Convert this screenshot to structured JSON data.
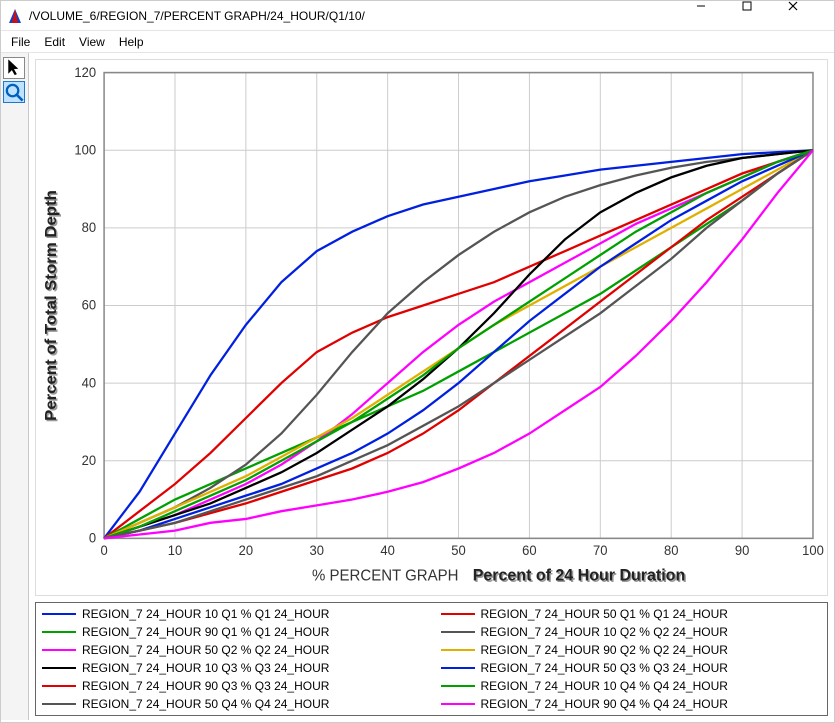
{
  "window": {
    "title": "/VOLUME_6/REGION_7/PERCENT GRAPH/24_HOUR/Q1/10/"
  },
  "menubar": [
    "File",
    "Edit",
    "View",
    "Help"
  ],
  "toolbar": {
    "pointer_tooltip": "Pointer",
    "zoom_tooltip": "Zoom"
  },
  "chart_data": {
    "type": "line",
    "title": "",
    "xlabel_prefix": "% PERCENT GRAPH",
    "xlabel": "Percent of 24 Hour Duration",
    "ylabel": "Percent of Total Storm Depth",
    "xlim": [
      0,
      100
    ],
    "ylim": [
      0,
      120
    ],
    "xticks": [
      0,
      10,
      20,
      30,
      40,
      50,
      60,
      70,
      80,
      90,
      100
    ],
    "yticks": [
      0,
      20,
      40,
      60,
      80,
      100,
      120
    ],
    "x": [
      0,
      5,
      10,
      15,
      20,
      25,
      30,
      35,
      40,
      45,
      50,
      55,
      60,
      65,
      70,
      75,
      80,
      85,
      90,
      95,
      100
    ],
    "series": [
      {
        "name": "REGION_7 24_HOUR 10 Q1 % Q1 24_HOUR",
        "color": "#0020e0",
        "values": [
          0,
          12,
          27,
          42,
          55,
          66,
          74,
          79,
          83,
          86,
          88,
          90,
          92,
          93.5,
          95,
          96,
          97,
          98,
          99,
          99.5,
          100
        ]
      },
      {
        "name": "REGION_7 24_HOUR 50 Q1 % Q1 24_HOUR",
        "color": "#e00000",
        "values": [
          0,
          7,
          14,
          22,
          31,
          40,
          48,
          53,
          57,
          60,
          63,
          66,
          70,
          74,
          78,
          82,
          86,
          90,
          94,
          97,
          100
        ]
      },
      {
        "name": "REGION_7 24_HOUR 90 Q1 % Q1 24_HOUR",
        "color": "#00a000",
        "values": [
          0,
          5,
          10,
          14,
          18,
          22,
          26,
          30,
          34,
          38,
          43,
          48,
          53,
          58,
          63,
          69,
          75,
          81,
          87,
          94,
          100
        ]
      },
      {
        "name": "REGION_7 24_HOUR 10 Q2 % Q2 24_HOUR",
        "color": "#555555",
        "values": [
          0,
          4,
          8,
          13,
          19,
          27,
          37,
          48,
          58,
          66,
          73,
          79,
          84,
          88,
          91,
          93.5,
          95.5,
          97,
          98,
          99,
          100
        ]
      },
      {
        "name": "REGION_7 24_HOUR 50 Q2 % Q2 24_HOUR",
        "color": "#ff00ff",
        "values": [
          0,
          3,
          6,
          10,
          14,
          19,
          25,
          32,
          40,
          48,
          55,
          61,
          66,
          71,
          76,
          81,
          85,
          89,
          93,
          97,
          100
        ]
      },
      {
        "name": "REGION_7 24_HOUR 90 Q2 % Q2 24_HOUR",
        "color": "#e0b000",
        "values": [
          0,
          4,
          8,
          12,
          16,
          21,
          26,
          31,
          37,
          43,
          49,
          55,
          60,
          65,
          70,
          75,
          80,
          85,
          90,
          95,
          100
        ]
      },
      {
        "name": "REGION_7 24_HOUR 10 Q3 % Q3 24_HOUR",
        "color": "#000000",
        "values": [
          0,
          3,
          6,
          9,
          13,
          17,
          22,
          28,
          34,
          41,
          49,
          58,
          68,
          77,
          84,
          89,
          93,
          96,
          98,
          99,
          100
        ]
      },
      {
        "name": "REGION_7 24_HOUR 50 Q3 % Q3 24_HOUR",
        "color": "#0020e0",
        "values": [
          0,
          2,
          5,
          8,
          11,
          14,
          18,
          22,
          27,
          33,
          40,
          48,
          56,
          63,
          70,
          76,
          82,
          87,
          92,
          96,
          100
        ]
      },
      {
        "name": "REGION_7 24_HOUR 90 Q3 % Q3 24_HOUR",
        "color": "#e00000",
        "values": [
          0,
          2,
          4,
          6.5,
          9,
          12,
          15,
          18,
          22,
          27,
          33,
          40,
          47,
          54,
          61,
          68,
          75,
          82,
          88,
          94,
          100
        ]
      },
      {
        "name": "REGION_7 24_HOUR 10 Q4 % Q4 24_HOUR",
        "color": "#00a000",
        "values": [
          0,
          3,
          7,
          11,
          15,
          20,
          25,
          30,
          36,
          42,
          49,
          55,
          61,
          67,
          73,
          79,
          84,
          89,
          93,
          97,
          100
        ]
      },
      {
        "name": "REGION_7 24_HOUR 50 Q4 % Q4 24_HOUR",
        "color": "#555555",
        "values": [
          0,
          2,
          4,
          7,
          10,
          13,
          16,
          20,
          24,
          29,
          34,
          40,
          46,
          52,
          58,
          65,
          72,
          80,
          87,
          94,
          100
        ]
      },
      {
        "name": "REGION_7 24_HOUR 90 Q4 % Q4 24_HOUR",
        "color": "#ff00ff",
        "values": [
          0,
          1,
          2,
          4,
          5,
          7,
          8.5,
          10,
          12,
          14.5,
          18,
          22,
          27,
          33,
          39,
          47,
          56,
          66,
          77,
          89,
          100
        ]
      }
    ]
  }
}
